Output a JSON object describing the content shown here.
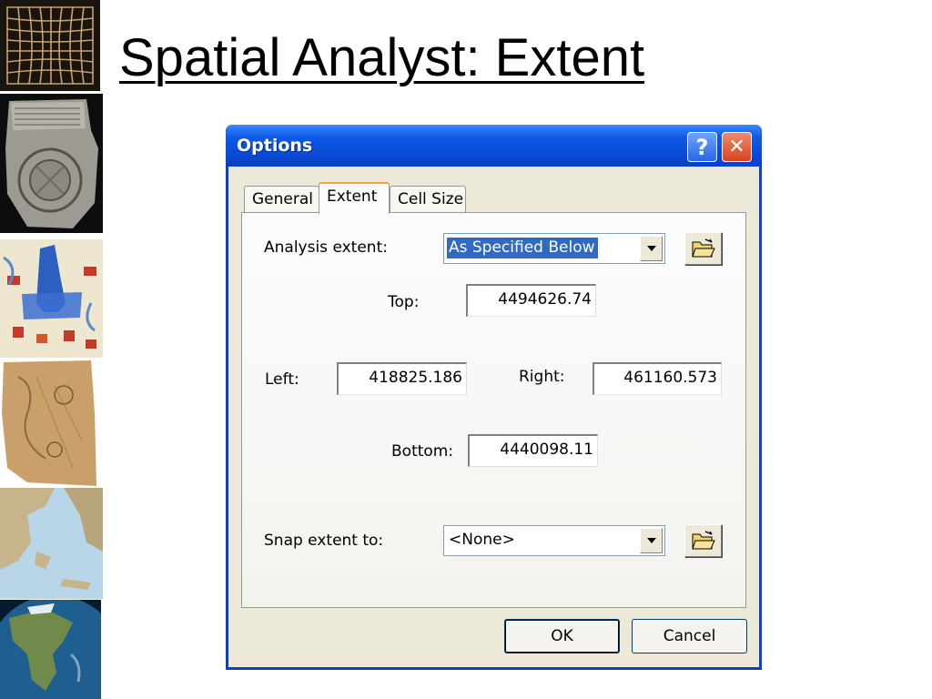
{
  "slide": {
    "title": "Spatial Analyst: Extent"
  },
  "dialog": {
    "title": "Options",
    "help_label": "?",
    "close_label": "✕",
    "tabs": [
      {
        "label": "General",
        "active": false
      },
      {
        "label": "Extent",
        "active": true
      },
      {
        "label": "Cell Size",
        "active": false
      }
    ],
    "analysis_extent_label": "Analysis extent:",
    "analysis_extent_value": "As Specified Below",
    "top_label": "Top:",
    "top_value": "4494626.74",
    "left_label": "Left:",
    "left_value": "418825.186",
    "right_label": "Right:",
    "right_value": "461160.573",
    "bottom_label": "Bottom:",
    "bottom_value": "4440098.11",
    "snap_label": "Snap extent to:",
    "snap_value": "<None>",
    "ok_label": "OK",
    "cancel_label": "Cancel"
  },
  "colors": {
    "titlebar": "#0a4ad8",
    "client": "#ece9d8",
    "selection": "#316ac5"
  }
}
